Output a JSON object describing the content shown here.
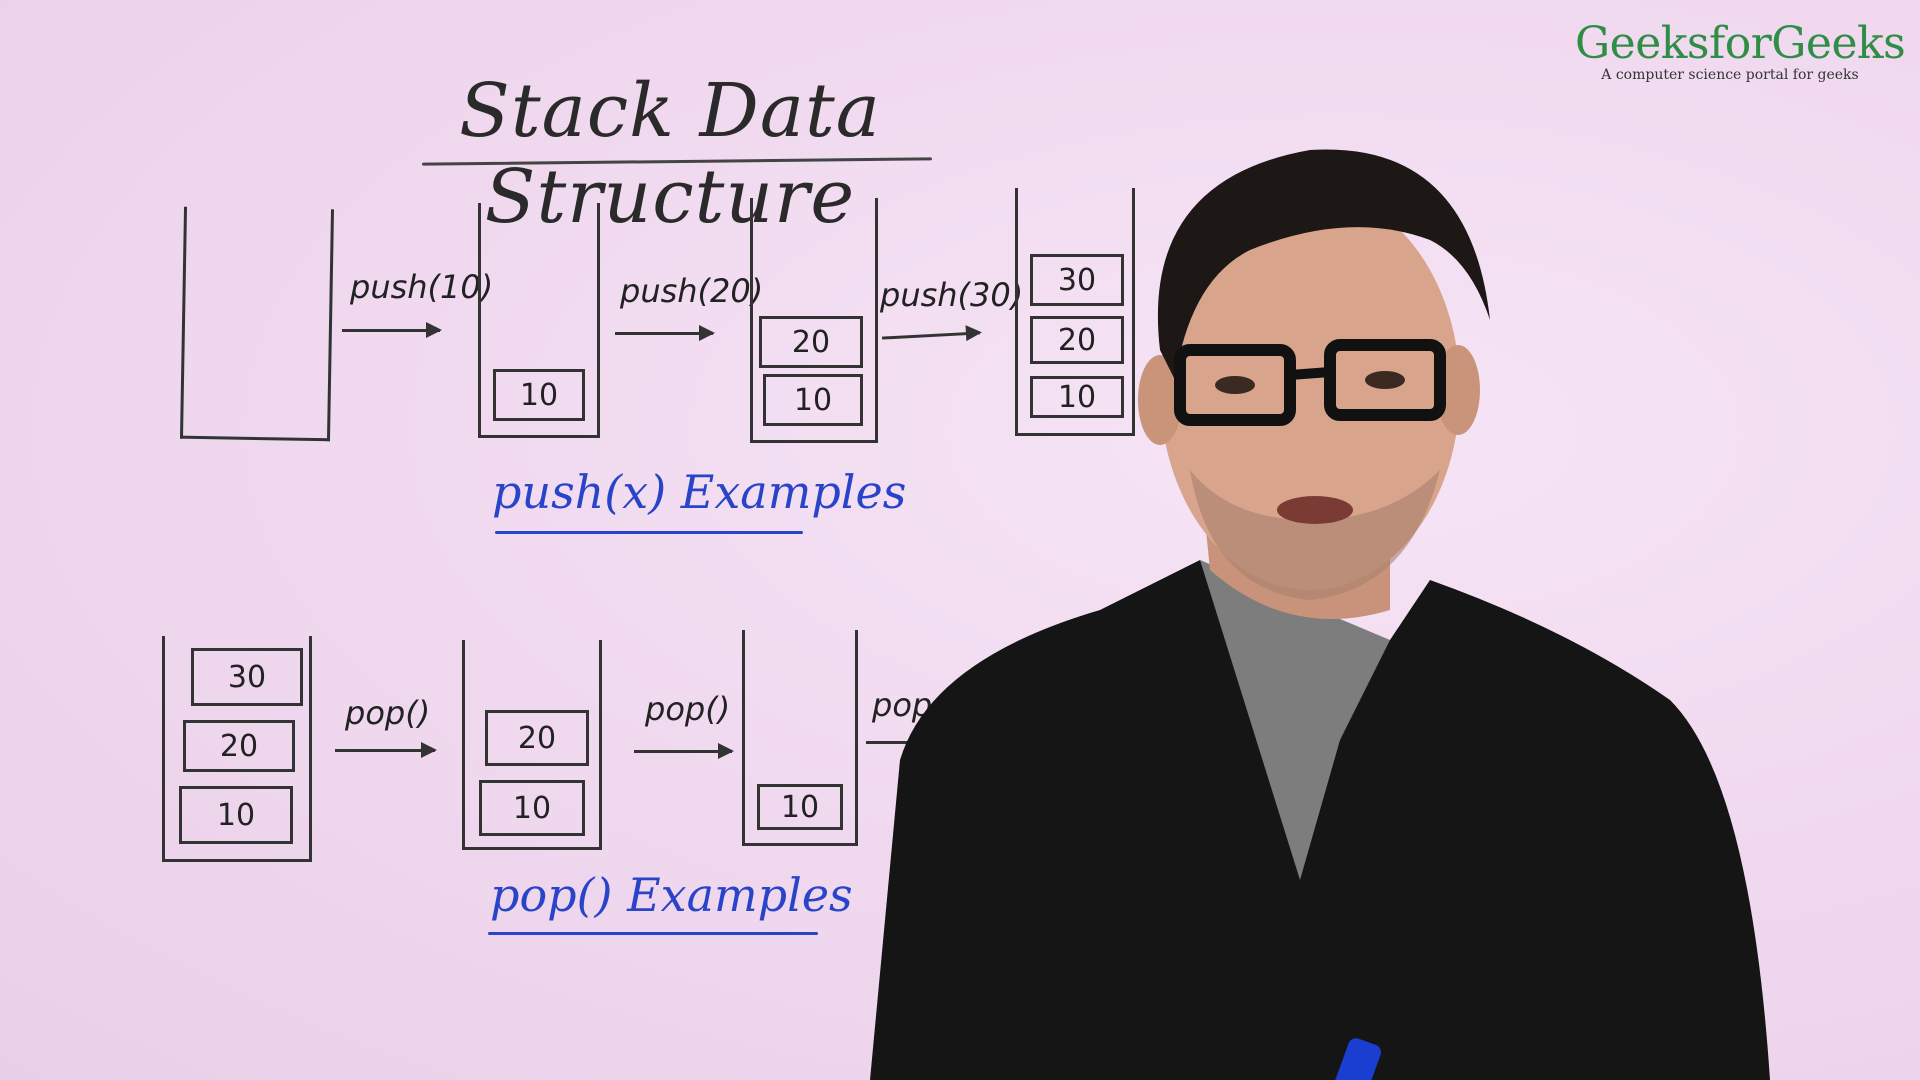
{
  "brand": {
    "name": "GeeksforGeeks",
    "tagline": "A computer science portal for geeks",
    "color": "#2f8d46"
  },
  "board": {
    "title": "Stack Data Structure",
    "push_section": {
      "label": "push(x) Examples",
      "ops": [
        "push(10)",
        "push(20)",
        "push(30)"
      ],
      "stacks": [
        [],
        [
          "10"
        ],
        [
          "20",
          "10"
        ],
        [
          "30",
          "20",
          "10"
        ]
      ]
    },
    "pop_section": {
      "label": "pop() Examples",
      "ops": [
        "pop()",
        "pop()",
        "pop()"
      ],
      "stacks": [
        [
          "30",
          "20",
          "10"
        ],
        [
          "20",
          "10"
        ],
        [
          "10"
        ]
      ]
    }
  },
  "colors": {
    "ink": "#333333",
    "marker_blue": "#2a44c9",
    "board": "#f3def3",
    "shirt": "#151515"
  }
}
